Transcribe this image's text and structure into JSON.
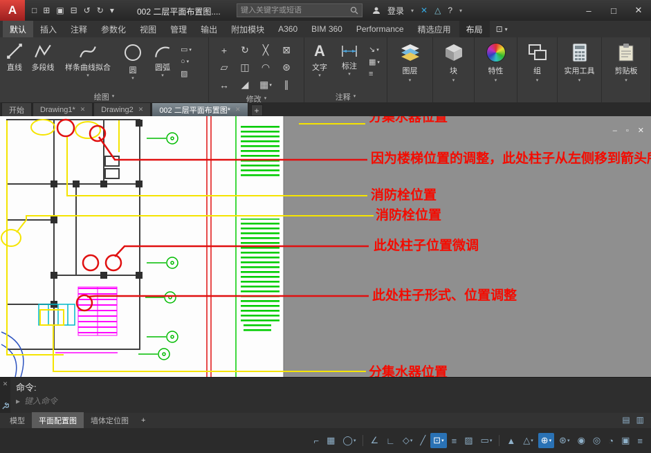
{
  "titlebar": {
    "logo_letter": "A",
    "qat": [
      {
        "glyph": "□"
      },
      {
        "glyph": "⊞"
      },
      {
        "glyph": "▣"
      },
      {
        "glyph": "⊟"
      },
      {
        "glyph": "↺"
      },
      {
        "glyph": "↻"
      },
      {
        "glyph": "▾"
      }
    ],
    "title": "002 二层平面布置图....",
    "search_placeholder": "键入关键字或短语",
    "signin_label": "登录",
    "exchange_glyph": "✕",
    "notification_glyph": "△",
    "help_label": "?",
    "window": {
      "minimize": "–",
      "maximize": "□",
      "close": "✕"
    }
  },
  "ribbon_tabs": [
    {
      "label": "默认"
    },
    {
      "label": "插入"
    },
    {
      "label": "注释"
    },
    {
      "label": "参数化"
    },
    {
      "label": "视图"
    },
    {
      "label": "管理"
    },
    {
      "label": "输出"
    },
    {
      "label": "附加模块"
    },
    {
      "label": "A360"
    },
    {
      "label": "BIM 360"
    },
    {
      "label": "Performance"
    },
    {
      "label": "精选应用"
    },
    {
      "label": "布局"
    }
  ],
  "ribbon_toggle": {
    "glyph": "⊡",
    "dd": "▾"
  },
  "ribbon": {
    "draw": {
      "panel_label": "绘图",
      "line": "直线",
      "polyline": "多段线",
      "spline": "样条曲线拟合",
      "circle": "圆",
      "arc": "圆弧",
      "small": [
        {
          "glyph": "▭",
          "dd": "▾"
        },
        {
          "glyph": "○",
          "dd": "▾"
        },
        {
          "glyph": "▨"
        }
      ]
    },
    "modify": {
      "panel_label": "修改",
      "icons": [
        {
          "glyph": "+"
        },
        {
          "glyph": "↻"
        },
        {
          "glyph": "╳"
        },
        {
          "glyph": "⊠"
        },
        {
          "glyph": "▱"
        },
        {
          "glyph": "◫"
        },
        {
          "glyph": "◠"
        },
        {
          "glyph": "⊛"
        },
        {
          "glyph": "↔"
        },
        {
          "glyph": "◢"
        },
        {
          "glyph": "▦",
          "dd": "▾"
        },
        {
          "glyph": "∥"
        }
      ]
    },
    "annotate": {
      "panel_label": "注释",
      "text_label": "文字",
      "text_glyph": "A",
      "dim_label": "标注",
      "small": [
        {
          "glyph": "↘",
          "dd": "▾"
        },
        {
          "glyph": "▦",
          "dd": "▾"
        },
        {
          "glyph": "≡"
        }
      ]
    },
    "layers_label": "图层",
    "block_label": "块",
    "properties_label": "特性",
    "group_label": "组",
    "utilities_label": "实用工具",
    "clipboard_label": "剪贴板"
  },
  "file_tabs": [
    {
      "label": "开始"
    },
    {
      "label": "Drawing1*",
      "close": "✕"
    },
    {
      "label": "Drawing2",
      "close": "✕"
    },
    {
      "label": "002 二层平面布置图*",
      "close": "✕"
    }
  ],
  "file_tab_add": "+",
  "drawing": {
    "window_controls": {
      "minimize": "–",
      "restore": "▫",
      "close": "✕"
    },
    "annotations": [
      {
        "text": "分集水器位置"
      },
      {
        "text": "因为楼梯位置的调整，此处柱子从左侧移到箭头所"
      },
      {
        "text": "消防栓位置"
      },
      {
        "text": "消防栓位置"
      },
      {
        "text": "此处柱子位置微调"
      },
      {
        "text": "此处柱子形式、位置调整"
      },
      {
        "text": "分集水器位置"
      }
    ]
  },
  "command": {
    "prompt": "命令:",
    "placeholder": "键入命令",
    "close": "✕",
    "input_marker": "▸"
  },
  "layout_tabs": [
    {
      "label": "模型"
    },
    {
      "label": "平面配置图"
    },
    {
      "label": "墙体定位图"
    }
  ],
  "layout_tab_add": "+",
  "tray_icons": [
    {
      "glyph": "▤"
    },
    {
      "glyph": "▥"
    }
  ],
  "status_icons": [
    {
      "name": "drafting-coords",
      "glyph": "⌐"
    },
    {
      "name": "grid",
      "glyph": "▦"
    },
    {
      "name": "snap",
      "glyph": "◯",
      "dd": "▾"
    },
    {
      "name": "infer",
      "glyph": "∠"
    },
    {
      "name": "ortho",
      "glyph": "∟"
    },
    {
      "name": "polar",
      "glyph": "◇",
      "dd": "▾"
    },
    {
      "name": "otrack",
      "glyph": "╱"
    },
    {
      "name": "osnap",
      "glyph": "⊡",
      "dd": "▾"
    },
    {
      "name": "lineweight",
      "glyph": "≡"
    },
    {
      "name": "transparency",
      "glyph": "▨"
    },
    {
      "name": "selection-cycling",
      "glyph": "▭",
      "dd": "▾"
    },
    {
      "name": "annotation-visibility",
      "glyph": "▲"
    },
    {
      "name": "autoscale",
      "glyph": "△",
      "dd": "▾"
    },
    {
      "name": "annotation-scale",
      "glyph": "⊕",
      "dd": "▾"
    },
    {
      "name": "workspace",
      "glyph": "⊛",
      "dd": "▾"
    },
    {
      "name": "annotation-monitor",
      "glyph": "◉"
    },
    {
      "name": "isolate",
      "glyph": "◎"
    },
    {
      "name": "hardware-acceleration",
      "glyph": "◔"
    },
    {
      "name": "clean-screen",
      "glyph": "▣"
    },
    {
      "name": "customization",
      "glyph": "≡"
    }
  ],
  "ui": {
    "dd": "▾"
  },
  "colors": {
    "annotation_red": "#f40b00",
    "leader_yellow": "#f5e400",
    "cad_green": "#00cc00",
    "cad_magenta": "#ff00ff",
    "cad_cyan": "#00b8c8",
    "active_blue": "#2a72b5",
    "ribbon_bg": "#3b3b3b"
  }
}
